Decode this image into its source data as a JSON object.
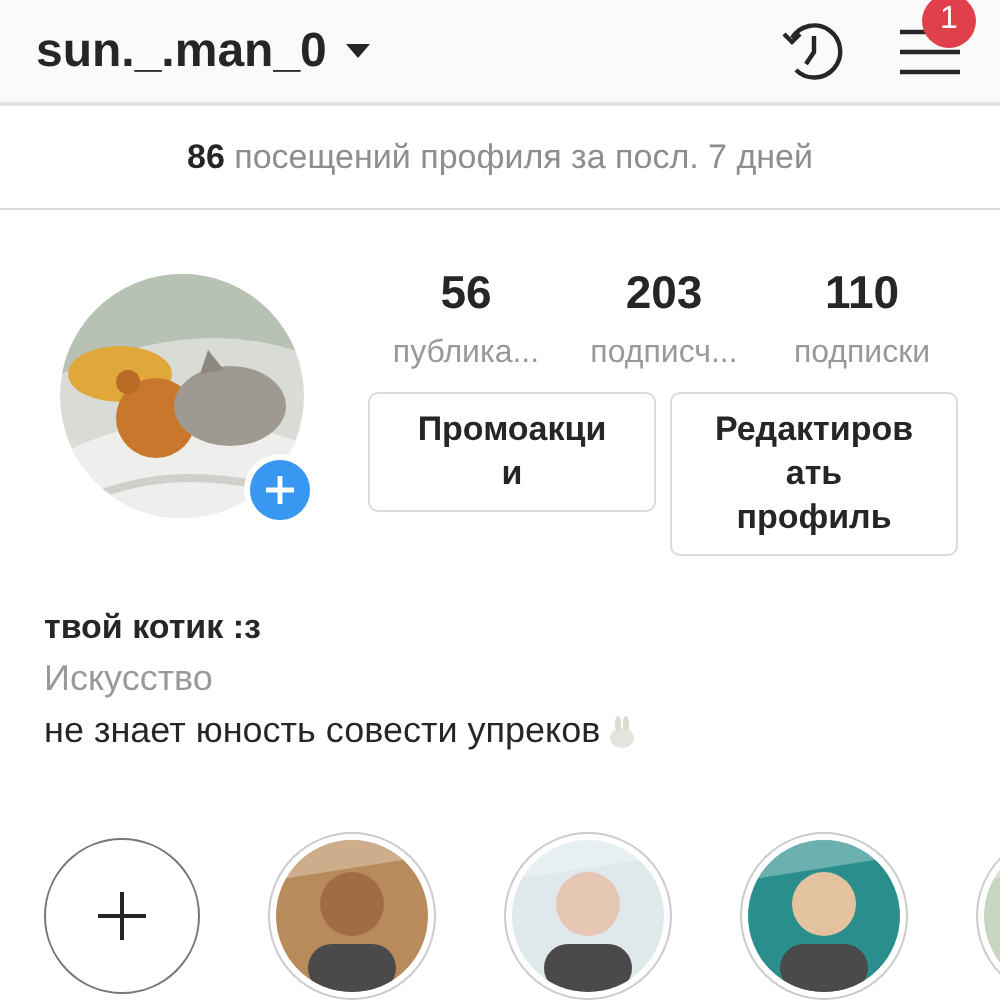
{
  "header": {
    "username": "sun._.man_0",
    "badge": "1"
  },
  "visits": {
    "count": "86",
    "text": "посещений профиля за посл. 7 дней"
  },
  "stats": [
    {
      "value": "56",
      "label": "публика..."
    },
    {
      "value": "203",
      "label": "подписч..."
    },
    {
      "value": "110",
      "label": "подписки"
    }
  ],
  "buttons": [
    {
      "lines": [
        "Промоакци",
        "и"
      ]
    },
    {
      "lines": [
        "Редактиров",
        "ать",
        "профиль"
      ]
    }
  ],
  "bio": {
    "name": "твой котик :з",
    "category": "Искусство",
    "text": "не знает юность совести упреков"
  },
  "highlights": [
    {
      "kind": "new"
    },
    {
      "kind": "picture"
    },
    {
      "kind": "picture"
    },
    {
      "kind": "picture"
    },
    {
      "kind": "picture"
    }
  ]
}
